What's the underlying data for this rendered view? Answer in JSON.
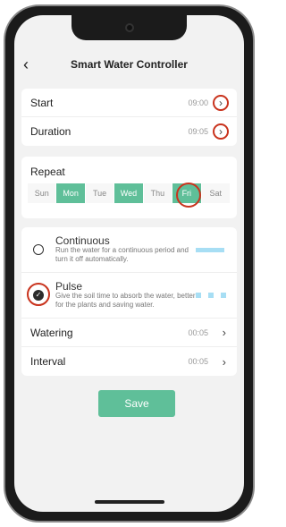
{
  "header": {
    "title": "Smart Water Controller",
    "back_icon": "chevron-left-icon"
  },
  "schedule": {
    "start_label": "Start",
    "start_value": "09:00",
    "duration_label": "Duration",
    "duration_value": "09:05"
  },
  "repeat": {
    "title": "Repeat",
    "days": [
      {
        "label": "Sun",
        "selected": false
      },
      {
        "label": "Mon",
        "selected": true
      },
      {
        "label": "Tue",
        "selected": false
      },
      {
        "label": "Wed",
        "selected": true
      },
      {
        "label": "Thu",
        "selected": false
      },
      {
        "label": "Fri",
        "selected": true
      },
      {
        "label": "Sat",
        "selected": false
      }
    ]
  },
  "modes": {
    "continuous_title": "Continuous",
    "continuous_desc": "Run the water for a continuous period and turn it off automatically.",
    "continuous_selected": false,
    "pulse_title": "Pulse",
    "pulse_desc": "Give the soil time to absorb the water, better for the plants and saving water.",
    "pulse_selected": true
  },
  "settings": {
    "watering_label": "Watering",
    "watering_value": "00:05",
    "interval_label": "Interval",
    "interval_value": "00:05"
  },
  "save_label": "Save",
  "colors": {
    "accent": "#5fbf99",
    "highlight_ring": "#c9331d",
    "pattern": "#a7def4"
  }
}
